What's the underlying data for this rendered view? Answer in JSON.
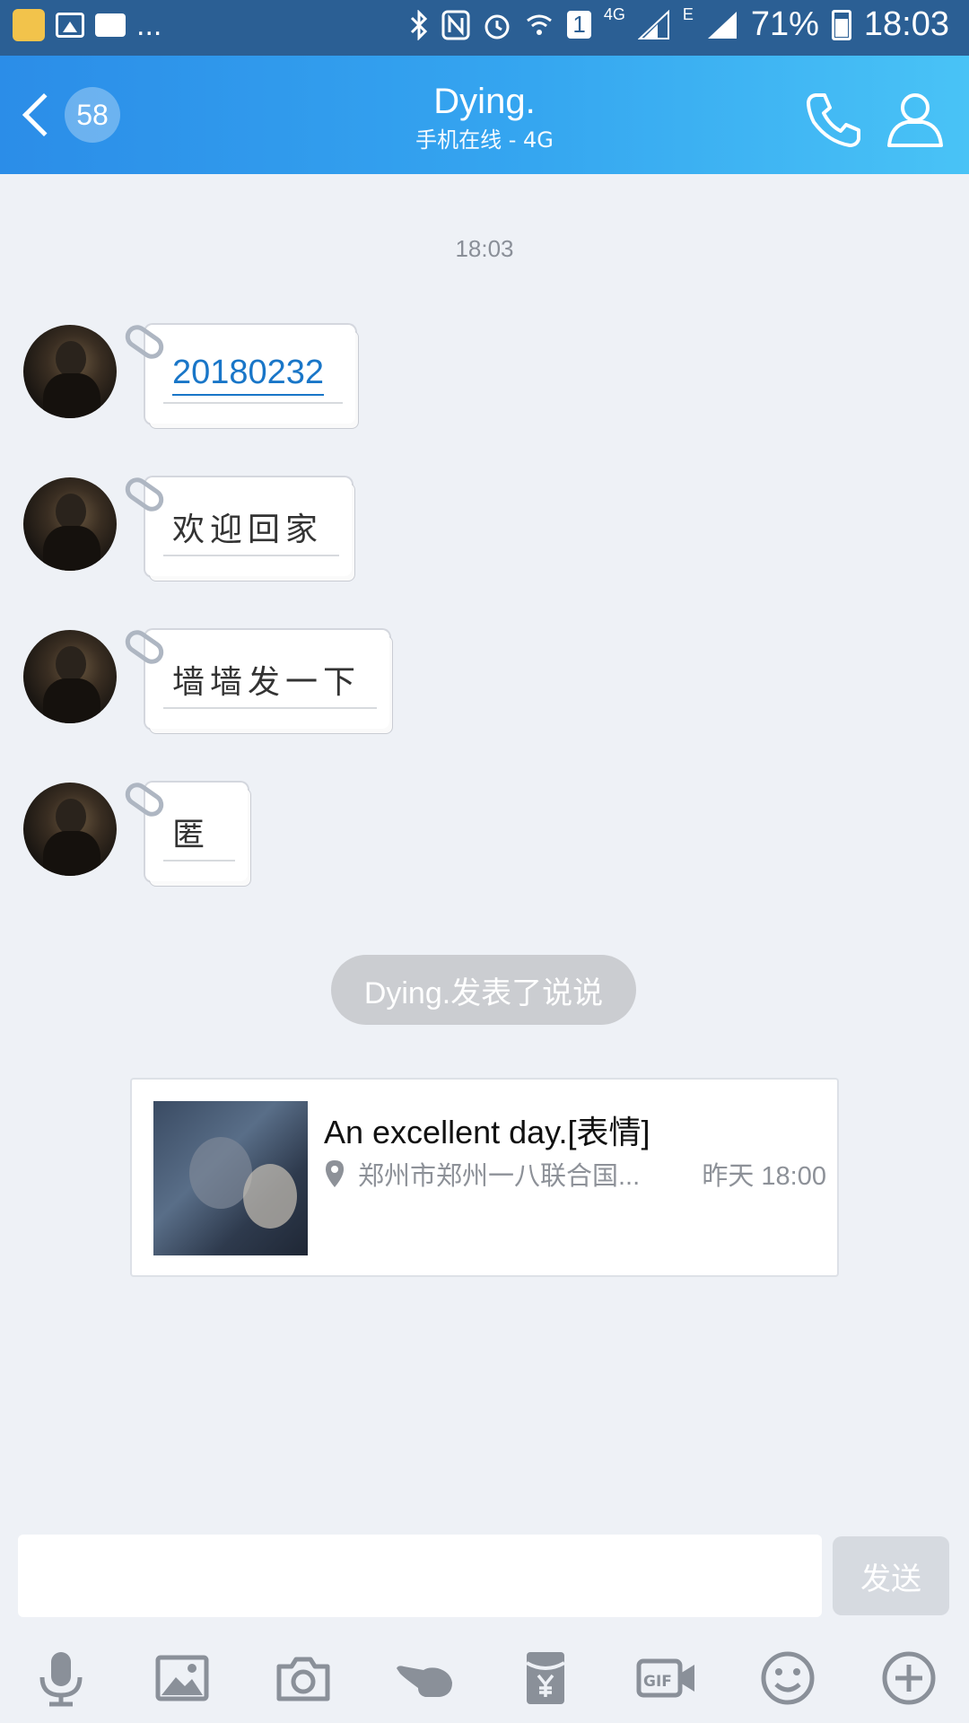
{
  "status_bar": {
    "more": "...",
    "network": "4G",
    "sim": "1",
    "edge": "E",
    "battery": "71%",
    "time": "18:03"
  },
  "header": {
    "unread_count": "58",
    "title": "Dying.",
    "subtitle": "手机在线 - 4G"
  },
  "chat": {
    "timestamp": "18:03",
    "messages": [
      {
        "text": "20180232"
      },
      {
        "text": "欢迎回家"
      },
      {
        "text": "墙墙发一下"
      },
      {
        "text": "匿"
      }
    ],
    "system_pill": "Dying.发表了说说",
    "feed_card": {
      "text": "An excellent day.[表情]",
      "location": "郑州市郑州一八联合国...",
      "time": "昨天 18:00"
    }
  },
  "input": {
    "value": "",
    "send_label": "发送"
  },
  "toolbar": {
    "items": [
      "microphone-icon",
      "image-icon",
      "camera-icon",
      "poke-icon",
      "red-packet-icon",
      "gif-icon",
      "emoji-icon",
      "add-icon"
    ]
  },
  "colors": {
    "header_start": "#2b8de8",
    "header_end": "#49c3f6",
    "background": "#eef1f6",
    "link": "#1976c8"
  }
}
